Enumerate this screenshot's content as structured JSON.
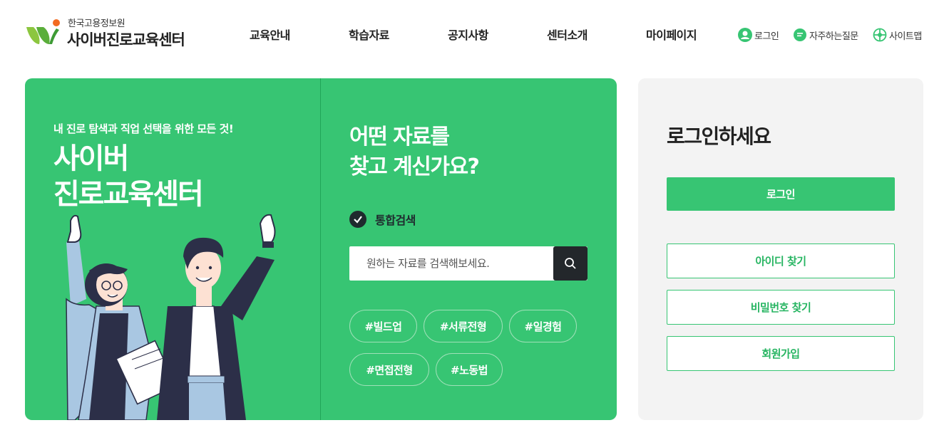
{
  "header": {
    "org_name": "한국고용정보원",
    "site_title": "사이버진로교육센터",
    "nav": [
      {
        "label": "교육안내"
      },
      {
        "label": "학습자료"
      },
      {
        "label": "공지사항"
      },
      {
        "label": "센터소개"
      },
      {
        "label": "마이페이지"
      }
    ],
    "util": {
      "login": {
        "label": "로그인",
        "icon": "user-icon"
      },
      "faq": {
        "label": "자주하는질문",
        "icon": "chat-icon"
      },
      "sitemap": {
        "label": "사이트맵",
        "icon": "sitemap-icon"
      }
    }
  },
  "hero": {
    "subtitle": "내 진로 탐색과 직업 선택을 위한 모든 것!",
    "title_line1": "사이버",
    "title_line2": "진로교육센터",
    "search": {
      "question_line1": "어떤 자료를",
      "question_line2": "찾고 계신가요?",
      "integrated_label": "통합검색",
      "placeholder": "원하는 자료를 검색해보세요.",
      "tags": [
        "#빌드업",
        "#서류전형",
        "#일경험",
        "#면접전형",
        "#노동법"
      ]
    }
  },
  "login": {
    "title": "로그인하세요",
    "login_button": "로그인",
    "find_id": "아이디 찾기",
    "find_password": "비밀번호 찾기",
    "signup": "회원가입"
  },
  "colors": {
    "brand_green": "#37c573",
    "dark": "#23272b",
    "panel_bg": "#f3f3f3"
  }
}
